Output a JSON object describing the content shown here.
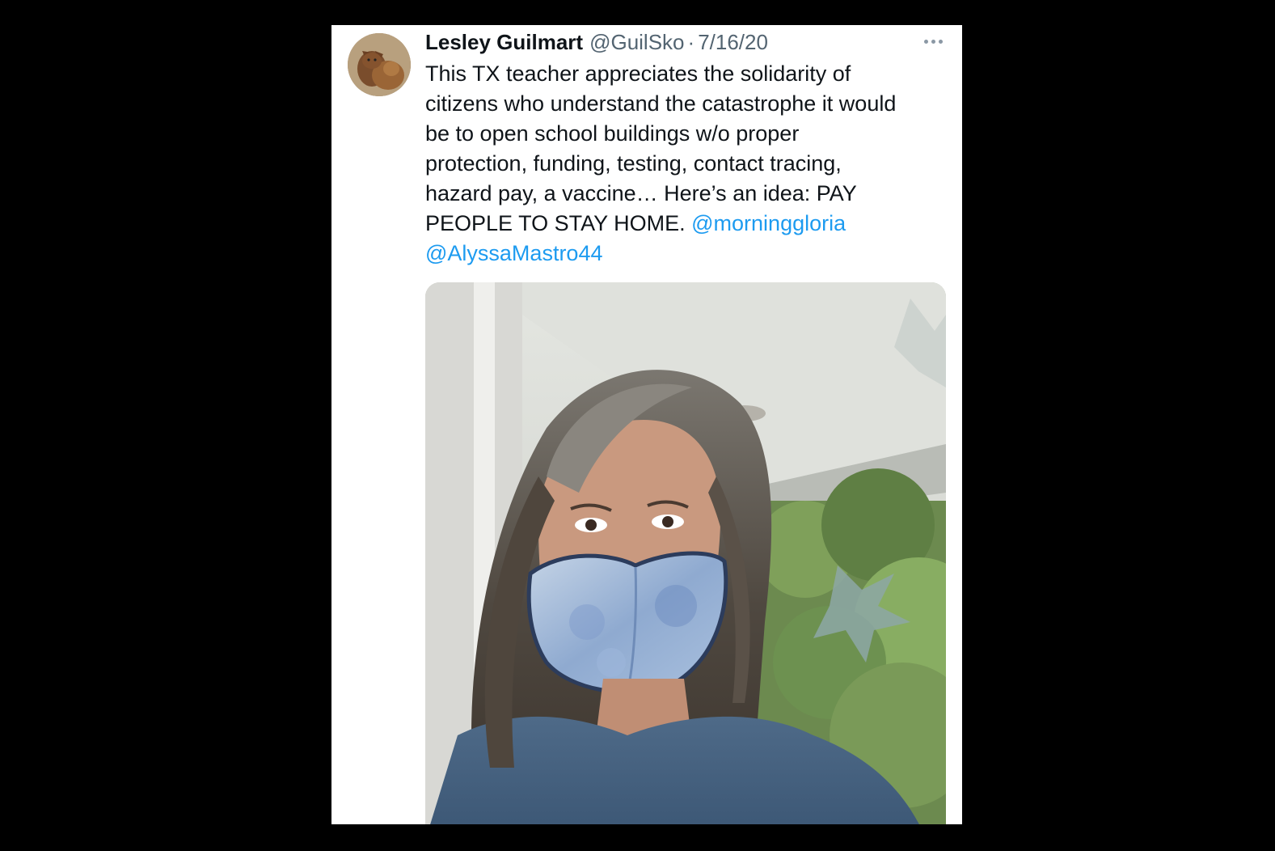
{
  "tweet": {
    "author_name": "Lesley Guilmart",
    "author_handle": "@GuilSko",
    "separator": "·",
    "date": "7/16/20",
    "more_icon": "more-horizontal-icon",
    "text_lines": [
      "This TX teacher appreciates the solidarity of",
      "citizens who understand the catastrophe it would",
      "be to open school buildings w/o proper",
      "protection, funding, testing, contact tracing,",
      "hazard pay, a vaccine… Here’s an idea: PAY",
      "PEOPLE TO STAY HOME."
    ],
    "mentions": [
      "@morninggloria",
      "@AlyssaMastro44"
    ]
  },
  "colors": {
    "background": "#000000",
    "card": "#ffffff",
    "text": "#0f1419",
    "muted": "#536471",
    "link": "#1d9bf0"
  }
}
